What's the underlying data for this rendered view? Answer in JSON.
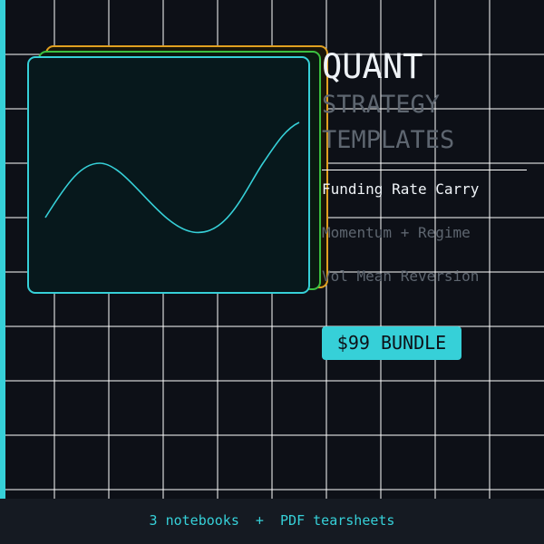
{
  "title": {
    "line1": "QUANT",
    "line2": "STRATEGY",
    "line3": "TEMPLATES"
  },
  "templates": [
    "Funding Rate Carry",
    "Momentum + Regime",
    "Vol Mean Reversion"
  ],
  "cta": "$99 BUNDLE",
  "footer": "3 notebooks  +  PDF tearsheets",
  "colors": {
    "accent": "#36d0d8",
    "orange": "#e0a020",
    "green": "#3cc040",
    "bg": "#0d1017"
  }
}
